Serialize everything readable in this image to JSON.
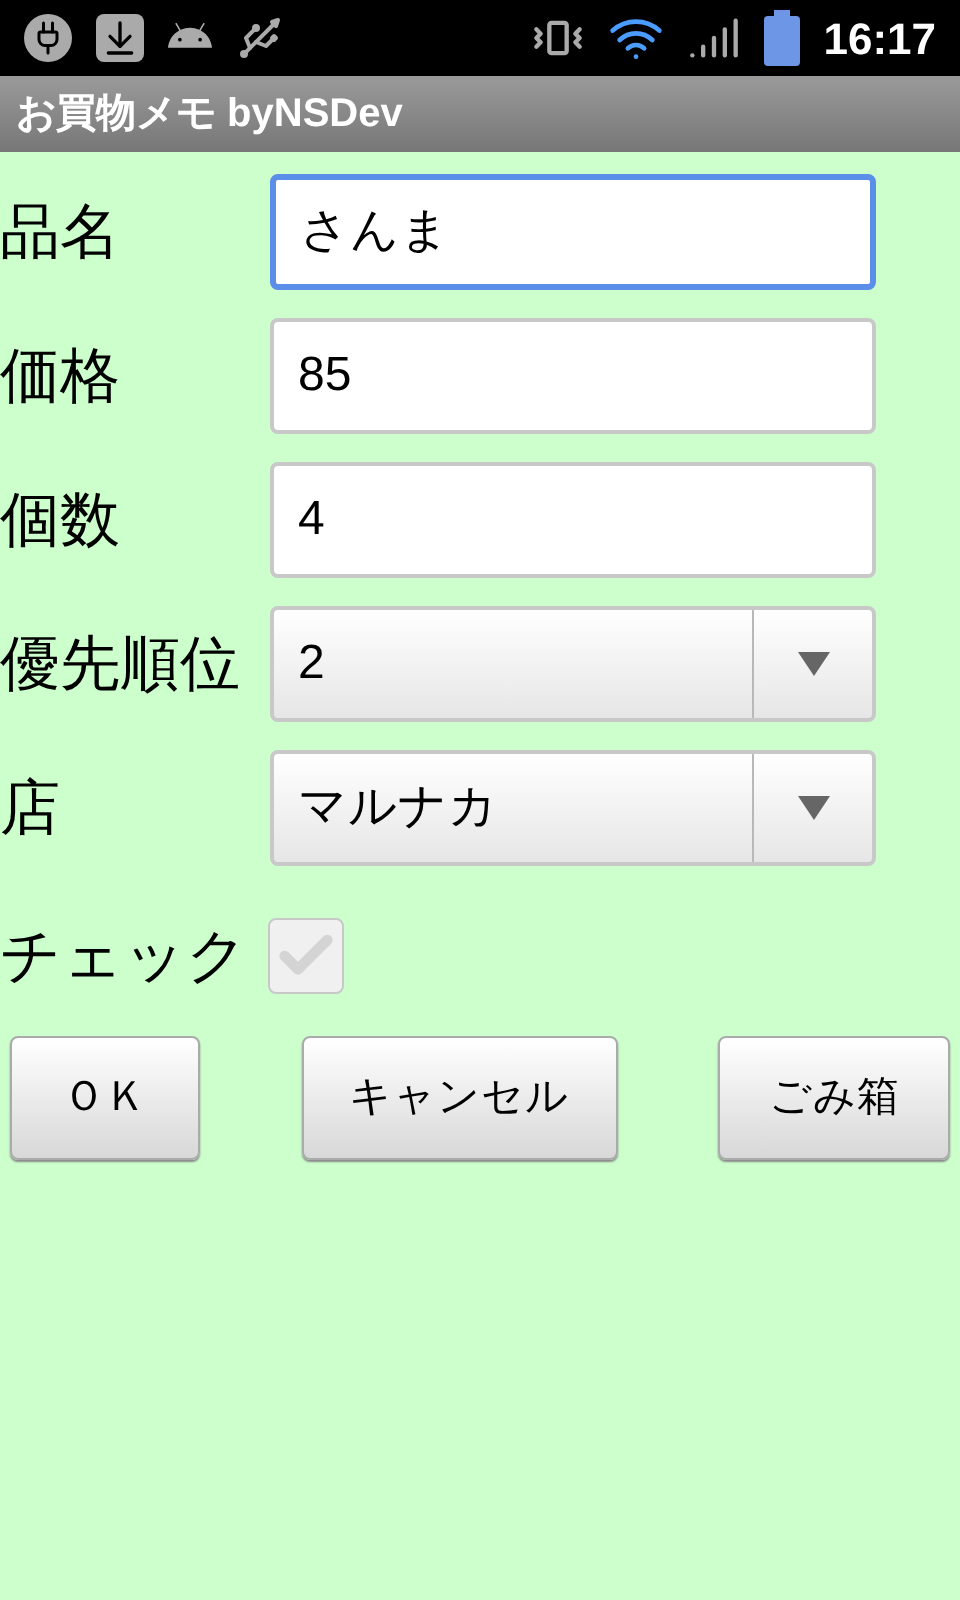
{
  "status_bar": {
    "time": "16:17"
  },
  "title_bar": {
    "title": "お買物メモ byNSDev"
  },
  "form": [
    {
      "kind": "text",
      "label": "品名",
      "value": "さんま",
      "focused": true
    },
    {
      "kind": "text",
      "label": "価格",
      "value": "85",
      "focused": false
    },
    {
      "kind": "text",
      "label": "個数",
      "value": "4",
      "focused": false
    },
    {
      "kind": "select",
      "label": "優先順位",
      "value": "2",
      "focused": false
    },
    {
      "kind": "select",
      "label": "店",
      "value": "マルナカ",
      "focused": false
    },
    {
      "kind": "checkbox",
      "label": "チェック",
      "checked": true,
      "disabled": true
    }
  ],
  "buttons": [
    {
      "label": "ＯＫ"
    },
    {
      "label": "キャンセル"
    },
    {
      "label": "ごみ箱"
    }
  ]
}
